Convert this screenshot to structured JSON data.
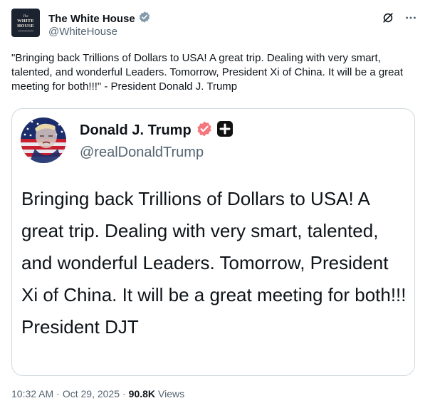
{
  "tweet": {
    "author": {
      "name": "The White House",
      "handle": "@WhiteHouse",
      "avatar_text": [
        "The",
        "WHITE",
        "HOUSE"
      ],
      "verified_color": "#829aab"
    },
    "text": "\"Bringing back Trillions of Dollars to USA! A great trip. Dealing with very smart, talented, and wonderful Leaders. Tomorrow, President Xi of China. It will be a great meeting for both!!!\" - President Donald J. Trump",
    "time": "10:32 AM",
    "separator": "·",
    "date": "Oct 29, 2025",
    "views_count": "90.8K",
    "views_label": "Views",
    "actions": {
      "grok_icon": "slashed-circle-icon",
      "more_icon": "more-icon"
    }
  },
  "quote": {
    "author": {
      "name": "Donald J. Trump",
      "handle": "@realDonaldTrump",
      "verified_color": "#f4777d"
    },
    "text": "Bringing back Trillions of Dollars to USA! A great trip. Dealing with very smart, talented, and wonderful Leaders. Tomorrow, President Xi of China. It will be a great meeting for both!!! President DJT"
  },
  "colors": {
    "text": "#0f1419",
    "secondary": "#536471",
    "border": "#cfd9de"
  }
}
